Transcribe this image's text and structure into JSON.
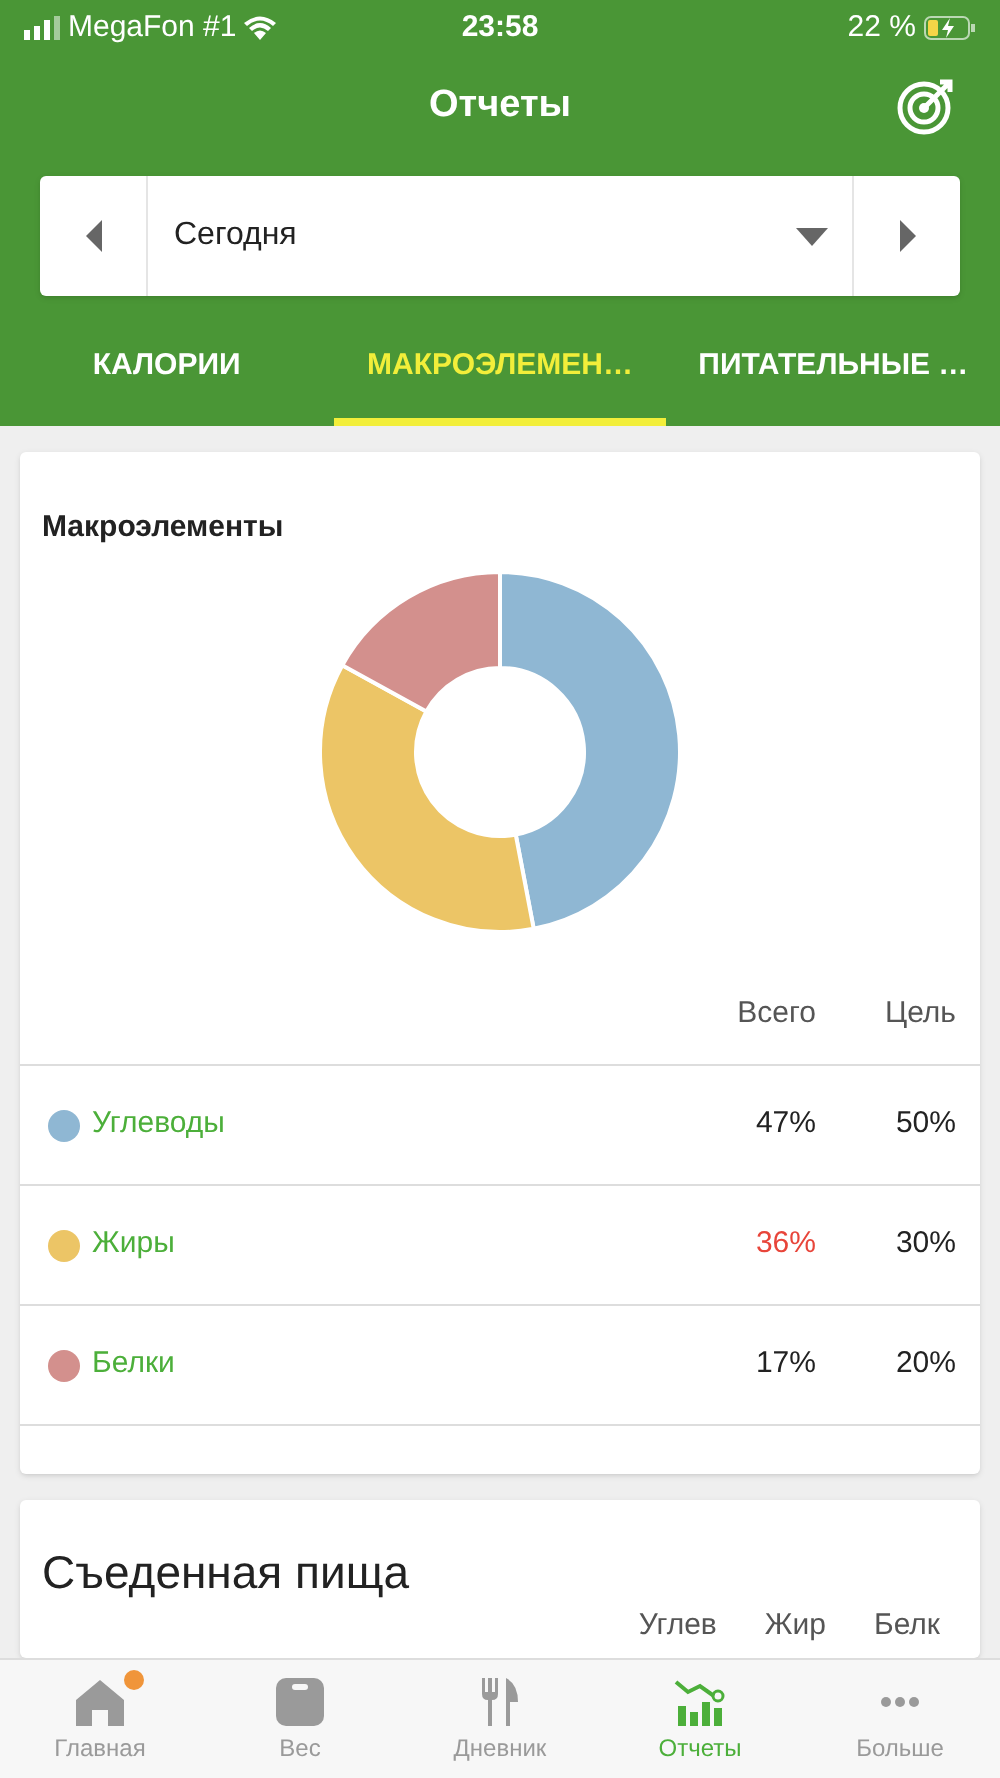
{
  "status_bar": {
    "carrier": "MegaFon #1",
    "time": "23:58",
    "battery": "22 %"
  },
  "header": {
    "title": "Отчеты"
  },
  "date_selector": {
    "value": "Сегодня"
  },
  "tabs": [
    {
      "label": "КАЛОРИИ",
      "selected": false
    },
    {
      "label": "МАКРОЭЛЕМЕН…",
      "selected": true
    },
    {
      "label": "ПИТАТЕЛЬНЫЕ …",
      "selected": false
    }
  ],
  "macros_card": {
    "title": "Макроэлементы",
    "chart_data": {
      "type": "donut",
      "categories": [
        "Углеводы",
        "Жиры",
        "Белки"
      ],
      "values": [
        47,
        36,
        17
      ],
      "colors": [
        "#8fb7d3",
        "#ecc566",
        "#d3908d"
      ]
    },
    "columns": [
      "Всего",
      "Цель"
    ],
    "rows": [
      {
        "color": "#8fb7d3",
        "total": "47%",
        "goal": "50%",
        "over_goal": false
      },
      {
        "color": "#ecc566",
        "total": "36%",
        "goal": "30%",
        "over_goal": true
      },
      {
        "color": "#d3908d",
        "total": "17%",
        "goal": "20%",
        "over_goal": false
      }
    ]
  },
  "food_card": {
    "title": "Съеденная пища",
    "columns": [
      "Углев",
      "Жир",
      "Белк"
    ]
  },
  "bottom_nav": [
    {
      "label": "Главная",
      "kind": "home",
      "selected": false,
      "badge": true
    },
    {
      "label": "Вес",
      "kind": "scale",
      "selected": false,
      "badge": false
    },
    {
      "label": "Дневник",
      "kind": "diary",
      "selected": false,
      "badge": false
    },
    {
      "label": "Отчеты",
      "kind": "reports",
      "selected": true,
      "badge": false
    },
    {
      "label": "Больше",
      "kind": "more",
      "selected": false,
      "badge": false
    }
  ]
}
